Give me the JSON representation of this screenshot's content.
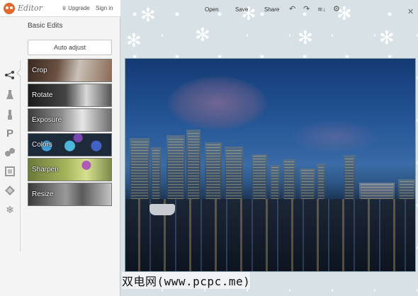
{
  "app": {
    "title": "Editor",
    "upgrade_label": "Upgrade",
    "signin_label": "Sign in"
  },
  "sidebar": {
    "section_title": "Basic Edits",
    "auto_adjust_label": "Auto adjust",
    "tools": [
      {
        "icon": "basic-edits-icon",
        "active": true
      },
      {
        "icon": "effects-flask-icon"
      },
      {
        "icon": "touch-up-brush-icon"
      },
      {
        "icon": "text-icon"
      },
      {
        "icon": "overlays-icon"
      },
      {
        "icon": "frames-icon"
      },
      {
        "icon": "textures-icon"
      },
      {
        "icon": "seasonal-snowflake-icon"
      }
    ],
    "edits": [
      {
        "id": "crop",
        "label": "Crop"
      },
      {
        "id": "rotate",
        "label": "Rotate"
      },
      {
        "id": "exposure",
        "label": "Exposure"
      },
      {
        "id": "colors",
        "label": "Colors"
      },
      {
        "id": "sharpen",
        "label": "Sharpen"
      },
      {
        "id": "resize",
        "label": "Resize"
      }
    ]
  },
  "toolbar": {
    "open_label": "Open",
    "save_label": "Save",
    "share_label": "Share",
    "icons": [
      "undo-icon",
      "redo-icon",
      "layers-icon",
      "settings-gear-icon",
      "close-icon"
    ]
  },
  "photo": {
    "description_icon": "city-skyline-photo"
  },
  "watermark": {
    "text": "双电网(www.pcpc.me)"
  },
  "colors": {
    "sidebar_bg": "#f4f4f4",
    "main_bg": "#d8e2e6",
    "text": "#444444"
  }
}
